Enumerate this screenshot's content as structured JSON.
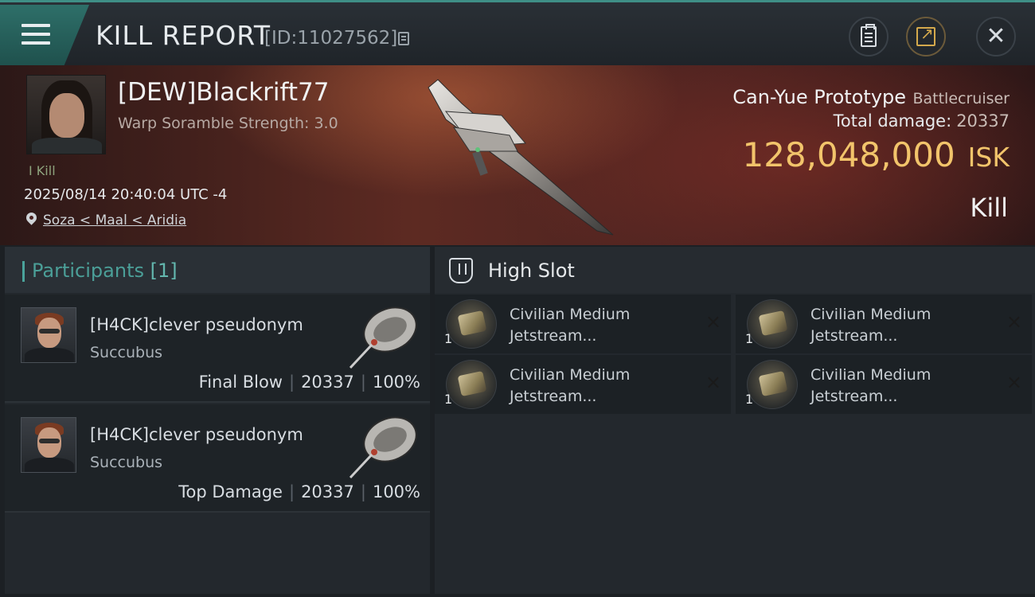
{
  "header": {
    "title": "KILL REPORT",
    "report_id": "[ID:11027562]",
    "icons": [
      "menu-icon",
      "copy-icon",
      "clipboard-icon",
      "share-icon",
      "close-icon"
    ]
  },
  "victim": {
    "name": "[DEW]Blackrift77",
    "scramble": "Warp Soramble Strength: 3.0",
    "kill_tag": "I Kill",
    "timestamp": "2025/08/14 20:40:04 UTC -4",
    "location": "Soza < Maal < Aridia",
    "ship_name": "Can-Yue Prototype",
    "ship_class": "Battlecruiser",
    "damage_label": "Total damage:",
    "damage_value": "20337",
    "isk_value": "128,048,000",
    "isk_unit": "ISK",
    "outcome": "Kill"
  },
  "participants": {
    "title": "Participants",
    "count": "[1]",
    "rows": [
      {
        "name": "[H4CK]clever pseudonym",
        "ship": "Succubus",
        "role": "Final Blow",
        "damage": "20337",
        "percent": "100%"
      },
      {
        "name": "[H4CK]clever pseudonym",
        "ship": "Succubus",
        "role": "Top Damage",
        "damage": "20337",
        "percent": "100%"
      }
    ],
    "separator": "|"
  },
  "fitting": {
    "slot_title": "High Slot",
    "items": [
      {
        "name": "Civilian Medium Jetstream...",
        "qty": "1"
      },
      {
        "name": "Civilian Medium Jetstream...",
        "qty": "1"
      },
      {
        "name": "Civilian Medium Jetstream...",
        "qty": "1"
      },
      {
        "name": "Civilian Medium Jetstream...",
        "qty": "1"
      }
    ],
    "remove_glyph": "×"
  },
  "colors": {
    "accent": "#4b9f98",
    "isk": "#f2c46b",
    "panel": "#23282d",
    "hero": "#5d2a22"
  }
}
